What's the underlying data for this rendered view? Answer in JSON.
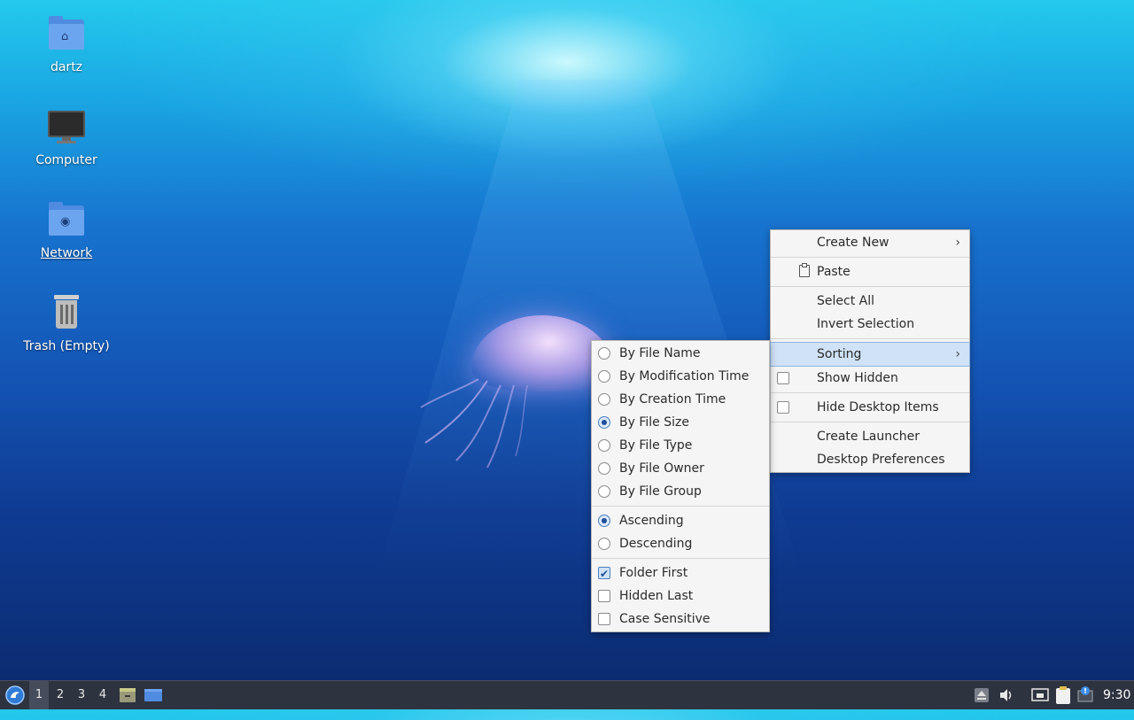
{
  "desktop": {
    "icons": [
      {
        "label": "dartz",
        "icon": "home-folder-icon"
      },
      {
        "label": "Computer",
        "icon": "computer-icon"
      },
      {
        "label": "Network",
        "icon": "network-folder-icon"
      },
      {
        "label": "Trash (Empty)",
        "icon": "trash-icon"
      }
    ]
  },
  "context_menu": {
    "items": {
      "create_new": "Create New",
      "paste": "Paste",
      "select_all": "Select All",
      "invert_selection": "Invert Selection",
      "sorting": "Sorting",
      "show_hidden": "Show Hidden",
      "hide_desktop_items": "Hide Desktop Items",
      "create_launcher": "Create Launcher",
      "desktop_preferences": "Desktop Preferences"
    },
    "checked": {
      "show_hidden": false,
      "hide_desktop_items": false
    },
    "highlighted": "Sorting"
  },
  "sorting_menu": {
    "sort_by": [
      {
        "label": "By File Name",
        "selected": false
      },
      {
        "label": "By Modification Time",
        "selected": false
      },
      {
        "label": "By Creation Time",
        "selected": false
      },
      {
        "label": "By File Size",
        "selected": true
      },
      {
        "label": "By File Type",
        "selected": false
      },
      {
        "label": "By File Owner",
        "selected": false
      },
      {
        "label": "By File Group",
        "selected": false
      }
    ],
    "order": [
      {
        "label": "Ascending",
        "selected": true
      },
      {
        "label": "Descending",
        "selected": false
      }
    ],
    "options": [
      {
        "label": "Folder First",
        "checked": true
      },
      {
        "label": "Hidden Last",
        "checked": false
      },
      {
        "label": "Case Sensitive",
        "checked": false
      }
    ]
  },
  "taskbar": {
    "workspaces": [
      "1",
      "2",
      "3",
      "4"
    ],
    "active_workspace": "1",
    "clock": "9:30",
    "tray_icons": [
      "eject-icon",
      "volume-icon",
      "network-icon",
      "clipboard-icon",
      "notification-icon"
    ]
  },
  "colors": {
    "accent": "#4a7fc0",
    "highlight": "#cfe2f6",
    "taskbar": "#2e3340"
  }
}
